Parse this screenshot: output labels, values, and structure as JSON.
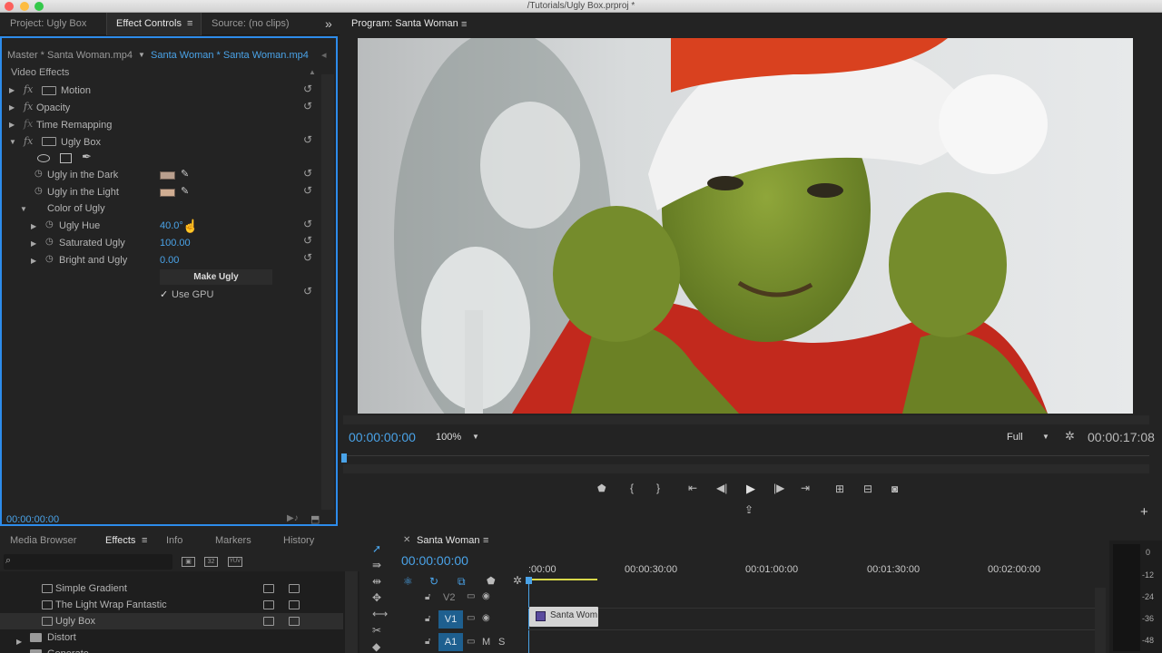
{
  "window": {
    "title": "/Tutorials/Ugly Box.prproj *"
  },
  "tabs": {
    "project": "Project: Ugly Box",
    "effect_controls": "Effect Controls",
    "source": "Source: (no clips)",
    "overflow": "»",
    "program": "Program: Santa Woman"
  },
  "effect_controls": {
    "master_clip": "Master * Santa Woman.mp4",
    "sequence_clip": "Santa Woman * Santa Woman.mp4",
    "section": "Video Effects",
    "effects": [
      {
        "label": "Motion"
      },
      {
        "label": "Opacity"
      },
      {
        "label": "Time Remapping"
      },
      {
        "label": "Ugly Box"
      }
    ],
    "params": {
      "dark_label": "Ugly in the Dark",
      "light_label": "Ugly in the Light",
      "group_label": "Color of Ugly",
      "hue_label": "Ugly Hue",
      "hue_value": "40.0°",
      "sat_label": "Saturated Ugly",
      "sat_value": "100.00",
      "bright_label": "Bright and Ugly",
      "bright_value": "0.00",
      "make_button": "Make Ugly",
      "gpu_check": "✓",
      "gpu_label": "Use GPU"
    },
    "timecode": "00:00:00:00",
    "colors": {
      "dark_swatch": "#b99f8e",
      "light_swatch": "#d0ad92",
      "accent": "#2d8ceb",
      "value": "#4aa3e8"
    }
  },
  "program": {
    "timecode_current": "00:00:00:00",
    "zoom": "100%",
    "quality": "Full",
    "timecode_duration": "00:00:17:08"
  },
  "lower_tabs": {
    "media_browser": "Media Browser",
    "effects": "Effects",
    "info": "Info",
    "markers": "Markers",
    "history": "History"
  },
  "effects_panel": {
    "items": [
      {
        "label": "Simple Gradient"
      },
      {
        "label": "The Light Wrap Fantastic"
      },
      {
        "label": "Ugly Box"
      },
      {
        "label": "Distort"
      },
      {
        "label": "Generate"
      }
    ],
    "badge_32": "32",
    "badge_yuv": "YUV"
  },
  "timeline": {
    "sequence": "Santa Woman",
    "timecode": "00:00:00:00",
    "ruler": [
      ":00:00",
      "00:00:30:00",
      "00:01:00:00",
      "00:01:30:00",
      "00:02:00:00"
    ],
    "tracks": [
      {
        "label": "V2"
      },
      {
        "label": "V1"
      },
      {
        "label": "A1",
        "mute": "M",
        "solo": "S"
      }
    ],
    "clip_label": "Santa Wom"
  },
  "meter": {
    "ticks": [
      "0",
      "-12",
      "-24",
      "-36",
      "-48"
    ]
  }
}
